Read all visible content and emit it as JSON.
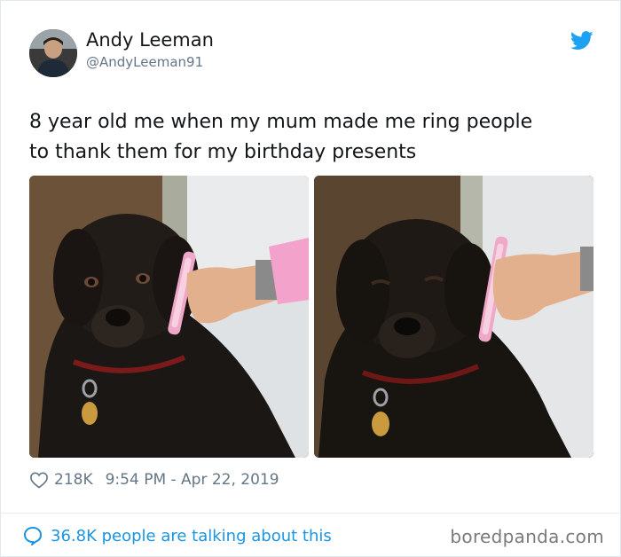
{
  "author": {
    "name": "Andy Leeman",
    "handle": "@AndyLeeman91"
  },
  "tweet": {
    "text_lines": [
      "8 year old me when my mum made me ring people",
      "to thank them for my birthday presents"
    ],
    "likes": "218K",
    "timestamp": "9:54 PM - Apr 22, 2019"
  },
  "conversation": {
    "label": "36.8K people are talking about this"
  },
  "watermark": "boredpanda.com",
  "icons": {
    "brand": "twitter-bird-icon",
    "like": "heart-icon",
    "reply": "speech-bubble-icon"
  },
  "colors": {
    "twitter_blue": "#1da1f2",
    "link_blue": "#1b95e0",
    "secondary_text": "#657786",
    "primary_text": "#14171a"
  }
}
